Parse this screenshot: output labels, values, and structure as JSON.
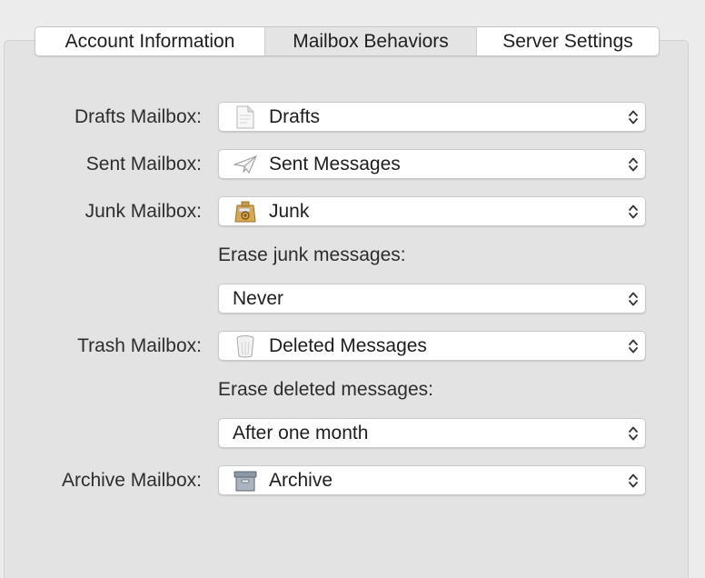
{
  "tabs": [
    {
      "label": "Account Information"
    },
    {
      "label": "Mailbox Behaviors"
    },
    {
      "label": "Server Settings"
    }
  ],
  "form": {
    "drafts": {
      "label": "Drafts Mailbox:",
      "value": "Drafts",
      "icon": "drafts-page-icon"
    },
    "sent": {
      "label": "Sent Mailbox:",
      "value": "Sent Messages",
      "icon": "paper-plane-icon"
    },
    "junk": {
      "label": "Junk Mailbox:",
      "value": "Junk",
      "icon": "junk-bag-icon"
    },
    "erase_junk": {
      "label": "Erase junk messages:",
      "value": "Never"
    },
    "trash": {
      "label": "Trash Mailbox:",
      "value": "Deleted Messages",
      "icon": "trash-can-icon"
    },
    "erase_deleted": {
      "label": "Erase deleted messages:",
      "value": "After one month"
    },
    "archive": {
      "label": "Archive Mailbox:",
      "value": "Archive",
      "icon": "archive-box-icon"
    }
  },
  "colors": {
    "window_bg": "#ececec",
    "panel_bg": "#e3e3e3",
    "control_bg": "#ffffff",
    "selected_tab_bg": "#e4e4e4"
  }
}
